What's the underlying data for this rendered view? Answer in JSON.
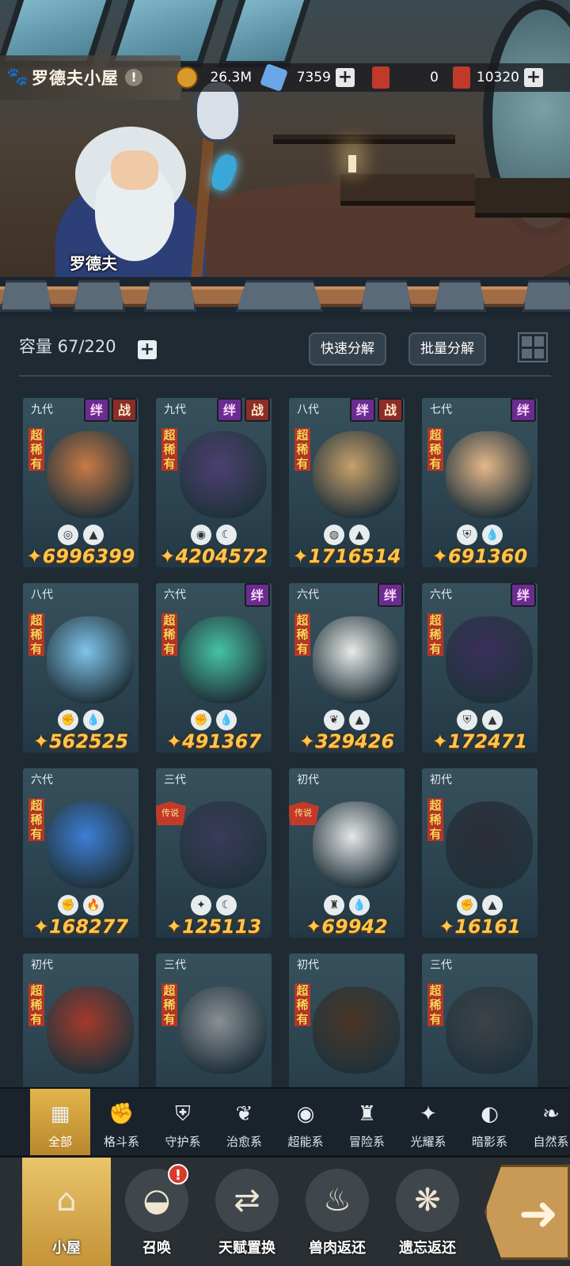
{
  "header": {
    "title": "罗德夫小屋",
    "info_icon": "exclamation-icon",
    "npc_name": "罗德夫"
  },
  "resources": [
    {
      "name": "gold-coin",
      "value": "26.3M",
      "has_plus": false,
      "color": "#d89a2a"
    },
    {
      "name": "crystal",
      "value": "7359",
      "has_plus": true,
      "color": "#6aa7e8"
    },
    {
      "name": "red-ticket",
      "value": "0",
      "has_plus": false,
      "color": "#c0392b"
    },
    {
      "name": "meat-ticket",
      "value": "10320",
      "has_plus": true,
      "color": "#c0392b"
    }
  ],
  "panel": {
    "capacity_label": "容量 67/220",
    "quick_decompose": "快速分解",
    "batch_decompose": "批量分解"
  },
  "cards": [
    {
      "gen": "九代",
      "tags": [
        "绊",
        "战"
      ],
      "rarity": "超稀有",
      "elements": [
        "guard-icon",
        "earth-icon"
      ],
      "power": "6996399",
      "color": "#c87a45"
    },
    {
      "gen": "九代",
      "tags": [
        "绊",
        "战"
      ],
      "rarity": "超稀有",
      "elements": [
        "eye-icon",
        "moon-icon"
      ],
      "power": "4204572",
      "color": "#4c3f70"
    },
    {
      "gen": "八代",
      "tags": [
        "绊",
        "战"
      ],
      "rarity": "超稀有",
      "elements": [
        "psychic-icon",
        "earth-icon"
      ],
      "power": "1716514",
      "color": "#c9a06a"
    },
    {
      "gen": "七代",
      "tags": [
        "绊"
      ],
      "rarity": "超稀有",
      "elements": [
        "shield-icon",
        "water-icon"
      ],
      "power": "691360",
      "color": "#e5b88a"
    },
    {
      "gen": "八代",
      "tags": [],
      "rarity": "超稀有",
      "elements": [
        "fist-icon",
        "water-icon"
      ],
      "power": "562525",
      "color": "#7fc4ea"
    },
    {
      "gen": "六代",
      "tags": [
        "绊"
      ],
      "rarity": "超稀有",
      "elements": [
        "fist-icon",
        "water-icon"
      ],
      "power": "491367",
      "color": "#45c4a2"
    },
    {
      "gen": "六代",
      "tags": [
        "绊"
      ],
      "rarity": "超稀有",
      "elements": [
        "leaf-icon",
        "earth-icon"
      ],
      "power": "329426",
      "color": "#e9eae6"
    },
    {
      "gen": "六代",
      "tags": [
        "绊"
      ],
      "rarity": "超稀有",
      "elements": [
        "shield-icon",
        "earth-icon"
      ],
      "power": "172471",
      "color": "#3a2e5a"
    },
    {
      "gen": "六代",
      "tags": [],
      "rarity": "超稀有",
      "elements": [
        "fist-icon",
        "fire-icon"
      ],
      "power": "168277",
      "color": "#3c7fd6"
    },
    {
      "gen": "三代",
      "tags": [],
      "rarity": "传说",
      "elements": [
        "light-icon",
        "moon-icon"
      ],
      "power": "125113",
      "color": "#3a3a5a"
    },
    {
      "gen": "初代",
      "tags": [],
      "rarity": "传说",
      "elements": [
        "adventure-icon",
        "water-icon"
      ],
      "power": "69942",
      "color": "#e6e6e6"
    },
    {
      "gen": "初代",
      "tags": [],
      "rarity": "超稀有",
      "elements": [
        "fist-icon",
        "earth-icon"
      ],
      "power": "16161",
      "color": "#2c2c36"
    },
    {
      "gen": "初代",
      "tags": [],
      "rarity": "超稀有",
      "elements": [],
      "power": "",
      "color": "#a33a2a"
    },
    {
      "gen": "三代",
      "tags": [],
      "rarity": "超稀有",
      "elements": [],
      "power": "",
      "color": "#8a8f94"
    },
    {
      "gen": "初代",
      "tags": [],
      "rarity": "超稀有",
      "elements": [],
      "power": "",
      "color": "#4a3526"
    },
    {
      "gen": "三代",
      "tags": [],
      "rarity": "超稀有",
      "elements": [],
      "power": "",
      "color": "#3d4248"
    }
  ],
  "filters": [
    {
      "label": "全部",
      "icon": "all-icon",
      "glyph": "▦",
      "active": true
    },
    {
      "label": "格斗系",
      "icon": "fist-icon",
      "glyph": "✊",
      "active": false
    },
    {
      "label": "守护系",
      "icon": "shield-icon",
      "glyph": "⛨",
      "active": false
    },
    {
      "label": "治愈系",
      "icon": "sprout-icon",
      "glyph": "❦",
      "active": false
    },
    {
      "label": "超能系",
      "icon": "alien-icon",
      "glyph": "◉",
      "active": false
    },
    {
      "label": "冒险系",
      "icon": "lantern-icon",
      "glyph": "♜",
      "active": false
    },
    {
      "label": "光耀系",
      "icon": "star-icon",
      "glyph": "✦",
      "active": false
    },
    {
      "label": "暗影系",
      "icon": "eye-icon",
      "glyph": "◐",
      "active": false
    },
    {
      "label": "自然系",
      "icon": "leaf-icon",
      "glyph": "❧",
      "active": false
    }
  ],
  "nav": [
    {
      "label": "小屋",
      "icon": "house-icon",
      "glyph": "⌂",
      "active": true
    },
    {
      "label": "召唤",
      "icon": "egg-icon",
      "glyph": "◒",
      "active": false,
      "alert": "!"
    },
    {
      "label": "天赋置换",
      "icon": "swap-icon",
      "glyph": "⇄",
      "active": false
    },
    {
      "label": "兽肉返还",
      "icon": "meat-icon",
      "glyph": "♨",
      "active": false
    },
    {
      "label": "遗忘返还",
      "icon": "flame-icon",
      "glyph": "❋",
      "active": false
    }
  ]
}
